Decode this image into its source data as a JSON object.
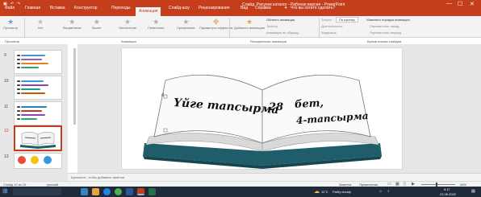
{
  "window": {
    "title": "Слайд. Рисунок каталог - Рабочая версия - PowerPoint",
    "search_hint": "Что вы хотите сделать?",
    "controls": [
      "—",
      "☐",
      "✕"
    ]
  },
  "menu_tabs": [
    {
      "label": "Файл"
    },
    {
      "label": "Главная"
    },
    {
      "label": "Вставка"
    },
    {
      "label": "Конструктор"
    },
    {
      "label": "Переходы"
    },
    {
      "label": "Анимация",
      "active": true
    },
    {
      "label": "Слайд-шоу"
    },
    {
      "label": "Рецензирование"
    },
    {
      "label": "Вид"
    },
    {
      "label": "Справка"
    }
  ],
  "ribbon": {
    "preview_label": "Просмотр",
    "animation_items": [
      {
        "label": "Нет",
        "icon": "star-icon"
      },
      {
        "label": "Выцветание",
        "icon": "star-icon"
      },
      {
        "label": "Вылет",
        "icon": "star-icon"
      },
      {
        "label": "Увеличение",
        "icon": "star-icon"
      },
      {
        "label": "Появление",
        "icon": "star-icon"
      },
      {
        "label": "Проявление",
        "icon": "star-icon"
      }
    ],
    "effects_label": "Параметры эффектов",
    "add_animation_label": "Добавить анимацию",
    "animation_panel_label": "Область анимации",
    "trigger_label": "Триггер",
    "painter_label": "Анимация по образцу",
    "start_label": "Запуск:",
    "start_value": "По щелчку",
    "duration_label": "Длительность:",
    "delay_label": "Задержка:",
    "reorder_label": "Изменить порядок анимации",
    "move_earlier_label": "Переместить назад",
    "move_later_label": "Переместить вперед",
    "group_labels": [
      "Просмотр",
      "Анимация",
      "Расширенная анимация",
      "Время показа слайдов"
    ]
  },
  "thumbnails": [
    {
      "number": "9"
    },
    {
      "number": "10"
    },
    {
      "number": "11"
    },
    {
      "number": "12",
      "active": true
    },
    {
      "number": "13"
    }
  ],
  "slide": {
    "line1": "Үйге тапсырма",
    "line1_num": "28",
    "line1_end": "бет,",
    "line2": "4-тапсырма",
    "text_marker": "d"
  },
  "notes_placeholder": "Щелкните, чтобы добавить заметки",
  "status": {
    "slide_info": "Слайд 12 из 15",
    "language": "русский",
    "notes_btn": "Заметки",
    "comments_btn": "Примечания",
    "zoom": "45%"
  },
  "taskbar": {
    "weather": "11°C",
    "weather_desc": "Partly cloudy",
    "time": "9:17",
    "date": "22.05.2022"
  },
  "colors": {
    "accent": "#c43e1c",
    "book_cover": "#1f5d6b",
    "taskbar": "#1f2a3a"
  }
}
